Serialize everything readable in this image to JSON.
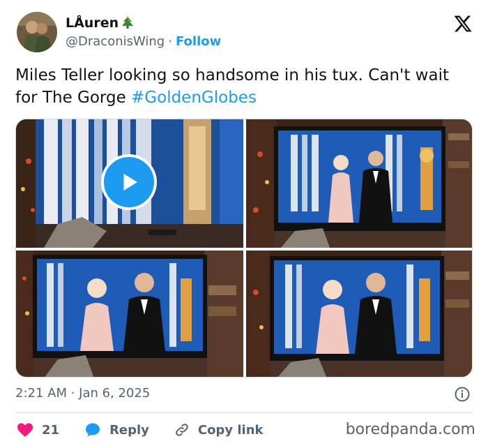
{
  "author": {
    "display_name": "LÅuren",
    "handle": "@DraconisWing",
    "separator": "·",
    "follow_label": "Follow"
  },
  "tweet": {
    "text": "Miles Teller looking so handsome in his tux. Can't wait for The Gorge ",
    "hashtag": "#GoldenGlobes"
  },
  "media": {
    "count": 4,
    "first_is_video": true
  },
  "meta": {
    "timestamp": "2:21 AM · Jan 6, 2025"
  },
  "actions": {
    "like_count": "21",
    "reply_label": "Reply",
    "copy_link_label": "Copy link"
  },
  "watermark": "boredpanda.com",
  "colors": {
    "accent": "#1d9bf0",
    "like": "#f91880",
    "muted": "#536471"
  }
}
